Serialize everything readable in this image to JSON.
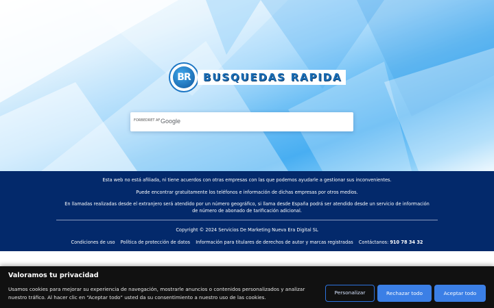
{
  "brand": {
    "badge_text": "BR",
    "name": "BUSQUEDAS RAPIDA"
  },
  "search": {
    "powered_by": "FORBEDRET AF",
    "provider": "Google",
    "value": "",
    "placeholder": ""
  },
  "footer": {
    "line1": "Esta web no está afiliada, ni tiene acuerdos con otras empresas con las que podemos ayudarle a gestionar sus inconvenientes.",
    "line2": "Puede encontrar gratuitamente los teléfonos e información de dichas empresas por otros medios.",
    "line3": "En llamadas realizadas desde el extranjero será atendido por un número geográfico, si llama desde España podrá ser atendido desde un servicio de información de número de abonado de tarificación adicional.",
    "copyright": "Copyright © 2024 Servicios De Marketing Nueva Era Digital SL",
    "links": [
      "Condiciones de uso",
      "Política de protección de datos",
      "Información para titulares de derechos de autor y marcas registradas"
    ],
    "contact_label": "Contáctanos:",
    "contact_phone": "910 78 34 32"
  },
  "cookie": {
    "title": "Valoramos tu privacidad",
    "text": "Usamos cookies para mejorar su experiencia de navegación, mostrarle anuncios o contenidos personalizados y analizar nuestro tráfico. Al hacer clic en “Aceptar todo” usted da su consentimiento a nuestro uso de las cookies.",
    "customize_label": "Personalizar",
    "reject_label": "Rechazar todo",
    "accept_label": "Aceptar todo"
  },
  "colors": {
    "footer_bg": "#03296b",
    "accent_blue": "#3b7fe6",
    "brand_blue": "#1a6cb3",
    "cookie_bg": "#111111"
  }
}
